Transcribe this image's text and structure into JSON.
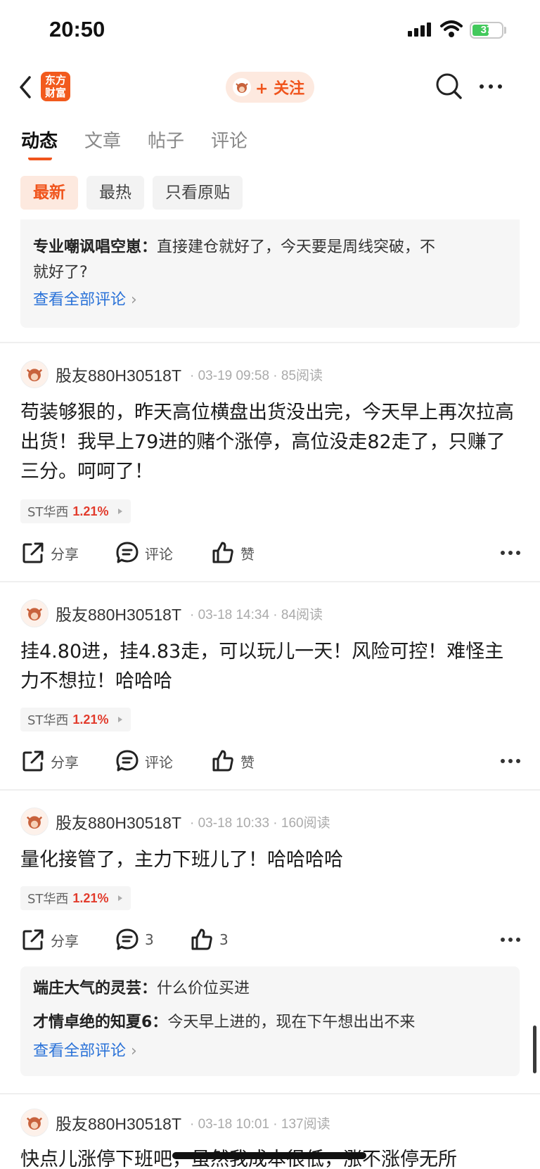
{
  "status_bar": {
    "time": "20:50",
    "battery": "37"
  },
  "nav": {
    "logo_text": "东方\n财富",
    "follow_label": "+ 关注"
  },
  "tabs": [
    {
      "label": "动态"
    },
    {
      "label": "文章"
    },
    {
      "label": "帖子"
    },
    {
      "label": "评论"
    }
  ],
  "filters": [
    {
      "label": "最新"
    },
    {
      "label": "最热"
    },
    {
      "label": "只看原贴"
    }
  ],
  "top_comments": {
    "items": [
      {
        "author": "专业嘲讽唱空崽：",
        "text": "直接建仓就好了，今天要是周线突破，不",
        "text2": "就好了?"
      }
    ],
    "see_all": "查看全部评论"
  },
  "posts": [
    {
      "user": "股友880H30518T",
      "meta": "· 03-19 09:58 · 85阅读",
      "body": "苟装够狠的，昨天高位横盘出货没出完，今天早上再次拉高出货！我早上79进的赌个涨停，高位没走82走了，只赚了三分。呵呵了！",
      "stock": "ST华西",
      "pct": "1.21%",
      "share": "分享",
      "comment": "评论",
      "like": "赞"
    },
    {
      "user": "股友880H30518T",
      "meta": "· 03-18 14:34 · 84阅读",
      "body": "挂4.80进，挂4.83走，可以玩儿一天！风险可控！难怪主力不想拉！哈哈哈",
      "stock": "ST华西",
      "pct": "1.21%",
      "share": "分享",
      "comment": "评论",
      "like": "赞"
    },
    {
      "user": "股友880H30518T",
      "meta": "· 03-18 10:33 · 160阅读",
      "body": "量化接管了，主力下班儿了！哈哈哈哈",
      "stock": "ST华西",
      "pct": "1.21%",
      "share": "分享",
      "comment": "3",
      "like": "3",
      "comments": [
        {
          "author": "端庄大气的灵芸：",
          "text": "什么价位买进"
        },
        {
          "author": "才情卓绝的知夏6：",
          "text": "今天早上进的，现在下午想出出不来"
        }
      ],
      "see_all": "查看全部评论"
    },
    {
      "user": "股友880H30518T",
      "meta": "· 03-18 10:01 · 137阅读",
      "body": "快点儿涨停下班吧，虽然我成本很低，涨不涨停无所"
    }
  ],
  "colors": {
    "accent": "#f0541c",
    "link": "#2a72d8",
    "rise": "#e23b2c"
  }
}
